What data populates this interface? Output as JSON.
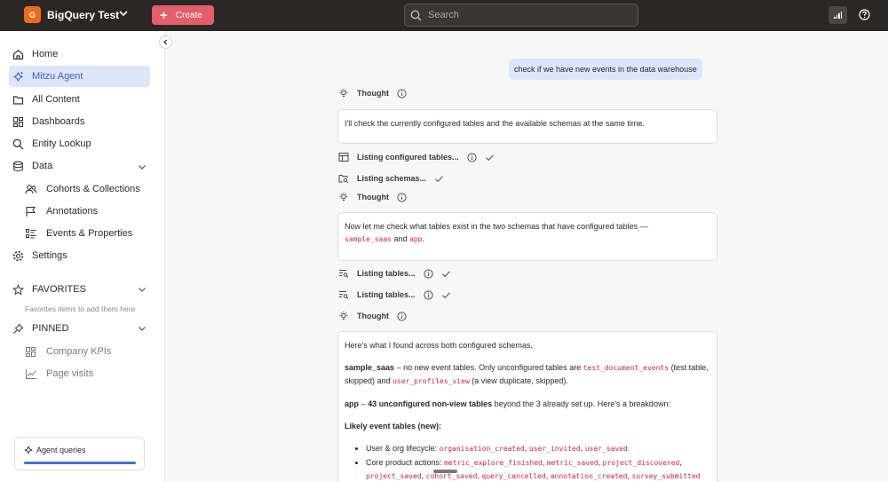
{
  "topbar": {
    "workspace_initial": "G",
    "workspace_name": "BigQuery Test",
    "create_label": "Create",
    "search_placeholder": "Search"
  },
  "sidebar": {
    "items": [
      {
        "label": "Home"
      },
      {
        "label": "Mitzu Agent"
      },
      {
        "label": "All Content"
      },
      {
        "label": "Dashboards"
      },
      {
        "label": "Entity Lookup"
      },
      {
        "label": "Data"
      }
    ],
    "data_children": [
      {
        "label": "Cohorts & Collections"
      },
      {
        "label": "Annotations"
      },
      {
        "label": "Events & Properties"
      }
    ],
    "settings_label": "Settings",
    "favorites_label": "FAVORITES",
    "favorites_hint": "Favorites items to add them here",
    "pinned_label": "PINNED",
    "pinned_items": [
      {
        "label": "Company KPIs"
      },
      {
        "label": "Page visits"
      }
    ],
    "agent_card_label": "Agent queries",
    "agent_card_progress": 1.0
  },
  "chat": {
    "user_message": "check if we have new events in the data warehouse",
    "thought_label": "Thought",
    "thought1_text": "I'll check the currently configured tables and the available schemas at the same time.",
    "step_configured_tables": "Listing configured tables...",
    "step_schemas": "Listing schemas...",
    "thought2_text_a": "Now let me check what tables exist in the two schemas that have configured tables —",
    "thought2_code1": "sample_saas",
    "thought2_and": "and",
    "thought2_code2": "app",
    "thought2_end": ".",
    "step_tables_1": "Listing tables...",
    "step_tables_2": "Listing tables...",
    "result_intro": "Here's what I found across both configured schemas.",
    "result_s1_name": "sample_saas",
    "result_s1_text_a": "– no new event tables. Only unconfigured tables are",
    "result_s1_code1": "test_document_events",
    "result_s1_text_b": "(test table, skipped) and",
    "result_s1_code2": "user_profiles_view",
    "result_s1_text_c": "(a view duplicate, skipped).",
    "result_s2_name": "app",
    "result_s2_sep": "–",
    "result_s2_bold": "43 unconfigured non-view tables",
    "result_s2_text": "beyond the 3 already set up. Here's a breakdown:",
    "likely_heading": "Likely event tables (new):",
    "bullet1_label": "User & org lifecycle:",
    "bullet1_codes": [
      "organisation_created",
      "user_invited",
      "user_saved"
    ],
    "bullet2_label": "Core product actions:",
    "bullet2_codes": [
      "metric_explore_finished",
      "metric_saved",
      "project_discovered",
      "project_saved",
      "cohort_saved",
      "query_cancelled",
      "annotation_created",
      "survey_submitted"
    ]
  },
  "colors": {
    "topbar_bg": "#2b2726",
    "accent_orange": "#ec6b1c",
    "create_red": "#e35d6a",
    "active_blue": "#3c5fc8",
    "user_bubble": "#dbe6f8",
    "code_pink": "#c7254e"
  }
}
